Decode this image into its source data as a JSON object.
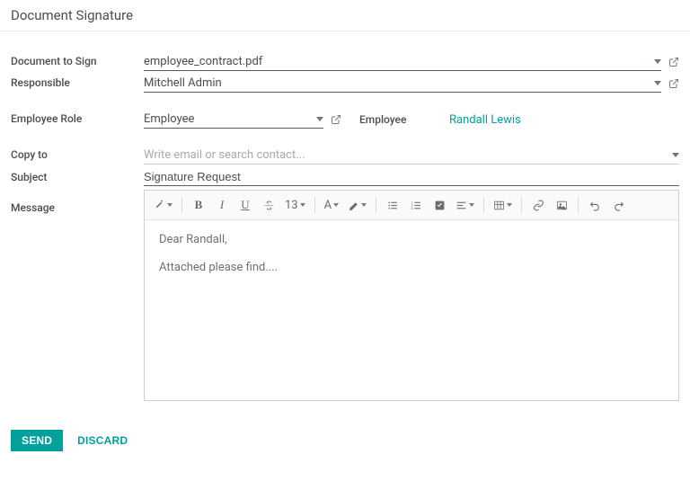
{
  "header": {
    "title": "Document Signature"
  },
  "labels": {
    "document": "Document to Sign",
    "responsible": "Responsible",
    "employee_role": "Employee Role",
    "employee": "Employee",
    "copy_to": "Copy to",
    "subject": "Subject",
    "message": "Message"
  },
  "fields": {
    "document": "employee_contract.pdf",
    "responsible": "Mitchell Admin",
    "employee_role": "Employee",
    "employee": "Randall Lewis",
    "copy_to_placeholder": "Write email or search contact...",
    "subject": "Signature Request"
  },
  "message": {
    "line1": "Dear Randall,",
    "line2": "Attached please find...."
  },
  "toolbar": {
    "font_size": "13",
    "font_letter": "A"
  },
  "footer": {
    "send": "Send",
    "discard": "Discard"
  }
}
